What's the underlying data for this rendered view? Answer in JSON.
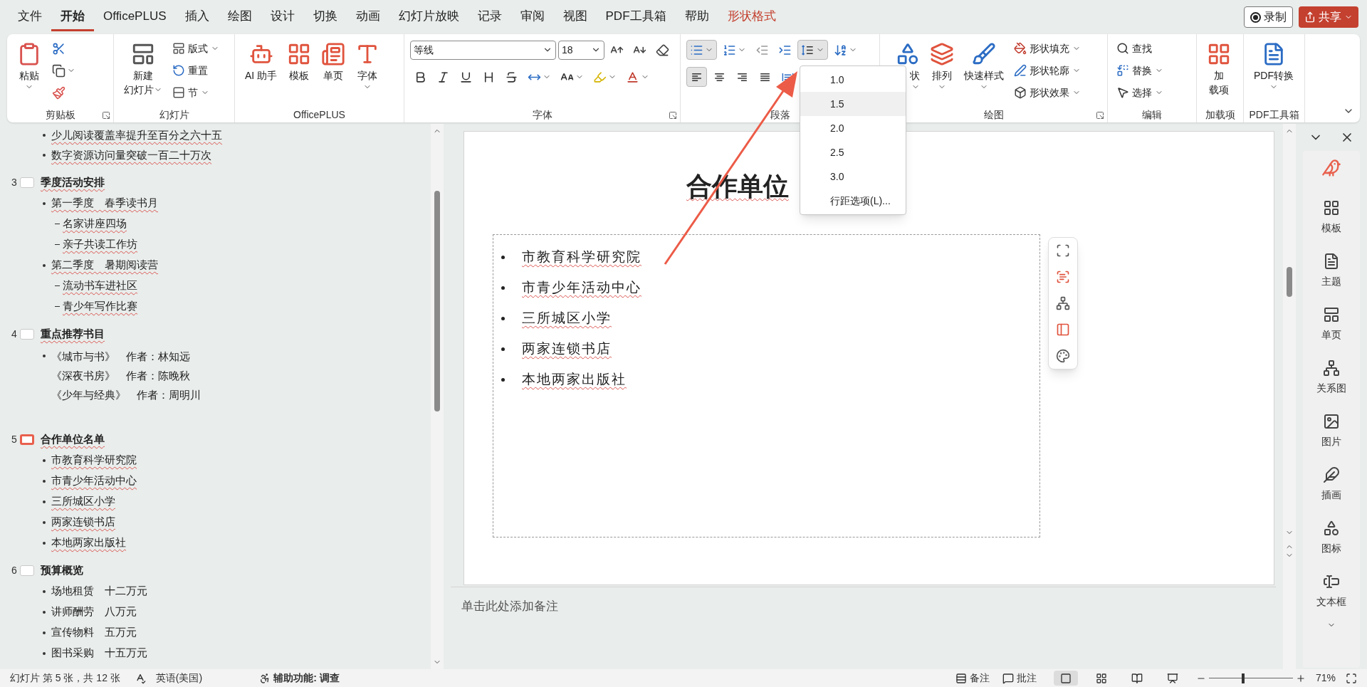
{
  "menu_tabs": [
    {
      "label": "文件",
      "selected": false,
      "kind": "normal"
    },
    {
      "label": "开始",
      "selected": true,
      "kind": "normal"
    },
    {
      "label": "OfficePLUS",
      "selected": false,
      "kind": "normal"
    },
    {
      "label": "插入",
      "selected": false,
      "kind": "normal"
    },
    {
      "label": "绘图",
      "selected": false,
      "kind": "normal"
    },
    {
      "label": "设计",
      "selected": false,
      "kind": "normal"
    },
    {
      "label": "切换",
      "selected": false,
      "kind": "normal"
    },
    {
      "label": "动画",
      "selected": false,
      "kind": "normal"
    },
    {
      "label": "幻灯片放映",
      "selected": false,
      "kind": "normal"
    },
    {
      "label": "记录",
      "selected": false,
      "kind": "normal"
    },
    {
      "label": "审阅",
      "selected": false,
      "kind": "normal"
    },
    {
      "label": "视图",
      "selected": false,
      "kind": "normal"
    },
    {
      "label": "PDF工具箱",
      "selected": false,
      "kind": "normal"
    },
    {
      "label": "帮助",
      "selected": false,
      "kind": "normal"
    },
    {
      "label": "形状格式",
      "selected": false,
      "kind": "contextual"
    }
  ],
  "record_button": "录制",
  "share_button": "共享",
  "ribbon": {
    "groups": [
      {
        "label": "剪贴板",
        "launcher": true,
        "columns": [
          {
            "kind": "large",
            "controls": [
              {
                "label": "粘贴",
                "dropdown": true
              }
            ]
          },
          {
            "kind": "stack",
            "controls": [
              {
                "kind": "icon",
                "dropdown": false
              },
              {
                "kind": "icon",
                "dropdown": true
              },
              {
                "kind": "icon",
                "dropdown": false
              }
            ]
          }
        ]
      },
      {
        "label": "幻灯片",
        "launcher": false,
        "columns": [
          {
            "kind": "large",
            "controls": [
              {
                "lines": [
                  "新建",
                  "幻灯片"
                ],
                "dropdown": true
              }
            ]
          },
          {
            "kind": "stack",
            "controls": [
              {
                "kind": "small",
                "label": "版式",
                "dropdown": true
              },
              {
                "kind": "small",
                "label": "重置",
                "dropdown": false
              },
              {
                "kind": "small",
                "label": "节",
                "dropdown": true
              }
            ]
          }
        ]
      },
      {
        "label": "OfficePLUS",
        "launcher": false,
        "columns": [
          {
            "kind": "large",
            "controls": [
              {
                "label": "AI 助手",
                "dropdown": false
              },
              {
                "label": "模板",
                "dropdown": false
              },
              {
                "label": "单页",
                "dropdown": false
              },
              {
                "label": "字体",
                "dropdown": true
              }
            ]
          }
        ]
      },
      {
        "label": "字体",
        "launcher": true,
        "columns": [
          {
            "kind": "rows",
            "rows": [
              [
                {
                  "kind": "combo",
                  "value": "等线"
                },
                {
                  "kind": "combo",
                  "value": "18"
                },
                {
                  "kind": "icon",
                  "dropdown": false
                },
                {
                  "kind": "icon",
                  "dropdown": false
                },
                {
                  "kind": "icon",
                  "dropdown": false
                }
              ],
              [
                {
                  "kind": "icon",
                  "dropdown": false
                },
                {
                  "kind": "icon",
                  "dropdown": false
                },
                {
                  "kind": "icon",
                  "dropdown": false
                },
                {
                  "kind": "icon",
                  "dropdown": false
                },
                {
                  "kind": "icon",
                  "dropdown": false
                },
                {
                  "kind": "icon",
                  "dropdown": true
                },
                {
                  "kind": "icon",
                  "dropdown": true
                },
                {
                  "kind": "icon",
                  "dropdown": true
                },
                {
                  "kind": "icon",
                  "dropdown": true
                }
              ]
            ]
          }
        ]
      },
      {
        "label": "段落",
        "launcher": false,
        "columns": [
          {
            "kind": "rows",
            "rows": [
              [
                {
                  "kind": "icon",
                  "dropdown": true,
                  "selected": true
                },
                {
                  "kind": "icon",
                  "dropdown": true,
                  "selected": false
                },
                {
                  "kind": "icon",
                  "dropdown": false,
                  "selected": false
                },
                {
                  "kind": "icon",
                  "dropdown": false,
                  "selected": false
                },
                {
                  "kind": "icon",
                  "dropdown": true,
                  "selected": true
                },
                {
                  "kind": "icon",
                  "dropdown": true,
                  "selected": false
                }
              ],
              [
                {
                  "kind": "icon",
                  "dropdown": false,
                  "selected": true
                },
                {
                  "kind": "icon",
                  "dropdown": false,
                  "selected": false
                },
                {
                  "kind": "icon",
                  "dropdown": false,
                  "selected": false
                },
                {
                  "kind": "icon",
                  "dropdown": false,
                  "selected": false
                },
                {
                  "kind": "icon",
                  "dropdown": false,
                  "selected": false
                }
              ]
            ]
          }
        ]
      },
      {
        "label": "绘图",
        "launcher": true,
        "columns": [
          {
            "kind": "large",
            "controls": [
              {
                "label": "状",
                "dropdown": true,
                "cut_left": true
              },
              {
                "label": "排列",
                "dropdown": true
              },
              {
                "label": "快速样式",
                "dropdown": true
              }
            ]
          },
          {
            "kind": "stack",
            "controls": [
              {
                "kind": "small",
                "label": "形状填充",
                "dropdown": true
              },
              {
                "kind": "small",
                "label": "形状轮廓",
                "dropdown": true
              },
              {
                "kind": "small",
                "label": "形状效果",
                "dropdown": true
              }
            ]
          }
        ]
      },
      {
        "label": "编辑",
        "launcher": false,
        "columns": [
          {
            "kind": "stack",
            "controls": [
              {
                "kind": "small",
                "label": "查找",
                "dropdown": false
              },
              {
                "kind": "small",
                "label": "替换",
                "dropdown": true
              },
              {
                "kind": "small",
                "label": "选择",
                "dropdown": true
              }
            ]
          }
        ]
      },
      {
        "label": "加载项",
        "launcher": false,
        "columns": [
          {
            "kind": "large",
            "controls": [
              {
                "lines": [
                  "加",
                  "载项"
                ],
                "dropdown": false
              }
            ]
          }
        ]
      },
      {
        "label": "PDF工具箱",
        "launcher": false,
        "columns": [
          {
            "kind": "large",
            "controls": [
              {
                "label": "PDF转换",
                "dropdown": true
              }
            ]
          }
        ]
      }
    ]
  },
  "line_spacing_menu": [
    {
      "label": "1.0",
      "highlighted": false
    },
    {
      "label": "1.5",
      "highlighted": true
    },
    {
      "label": "2.0",
      "highlighted": false
    },
    {
      "label": "2.5",
      "highlighted": false
    },
    {
      "label": "3.0",
      "highlighted": false
    },
    {
      "label": "行距选项(L)...",
      "highlighted": false
    }
  ],
  "outline": {
    "continued_items": [
      {
        "text": "少儿阅读覆盖率提升至百分之六十五",
        "flagged": true
      },
      {
        "text": "数字资源访问量突破一百二十万次",
        "flagged": true
      }
    ],
    "slides": [
      {
        "number": "3",
        "title": "季度活动安排",
        "selected": false,
        "flagged": true,
        "items": [
          {
            "text": "第一季度　春季读书月",
            "flagged": true,
            "children": [
              {
                "text": "名家讲座四场",
                "flagged": true
              },
              {
                "text": "亲子共读工作坊",
                "flagged": true
              }
            ]
          },
          {
            "text": "第二季度　暑期阅读营",
            "flagged": true,
            "children": [
              {
                "text": "流动书车进社区",
                "flagged": true
              },
              {
                "text": "青少年写作比赛",
                "flagged": true
              }
            ]
          }
        ]
      },
      {
        "number": "4",
        "title": "重点推荐书目",
        "selected": false,
        "flagged": true,
        "items": [
          {
            "lines": [
              "《城市与书》　作者：林知远",
              "《深夜书房》　作者：陈晚秋",
              "《少年与经典》　作者：周明川"
            ],
            "flagged": false
          }
        ]
      },
      {
        "number": "5",
        "title": "合作单位名单",
        "selected": true,
        "flagged": true,
        "items": [
          {
            "text": "市教育科学研究院",
            "flagged": true
          },
          {
            "text": "市青少年活动中心",
            "flagged": true
          },
          {
            "text": "三所城区小学",
            "flagged": true
          },
          {
            "text": "两家连锁书店",
            "flagged": true
          },
          {
            "text": "本地两家出版社",
            "flagged": true
          }
        ]
      },
      {
        "number": "6",
        "title": "预算概览",
        "selected": false,
        "flagged": false,
        "items": [
          {
            "text": "场地租赁　十二万元",
            "flagged": false
          },
          {
            "text": "讲师酬劳　八万元",
            "flagged": false
          },
          {
            "text": "宣传物料　五万元",
            "flagged": false
          },
          {
            "text": "图书采购　十五万元",
            "flagged": false
          }
        ]
      }
    ]
  },
  "slide": {
    "title": "合作单位",
    "bullets": [
      "市教育科学研究院",
      "市青少年活动中心",
      "三所城区小学",
      "两家连锁书店",
      "本地两家出版社"
    ]
  },
  "notes_placeholder": "单击此处添加备注",
  "side_panel": {
    "items": [
      "模板",
      "主题",
      "单页",
      "关系图",
      "图片",
      "插画",
      "图标",
      "文本框"
    ]
  },
  "status_bar": {
    "slide_info": "幻灯片 第 5 张，共 12 张",
    "language": "英语(美国)",
    "accessibility": "辅助功能: 调查",
    "notes": "备注",
    "comments": "批注",
    "views": [
      {
        "selected": true
      },
      {
        "selected": false
      },
      {
        "selected": false
      },
      {
        "selected": false
      }
    ],
    "zoom": {
      "level": 0.41,
      "reading": "71%"
    }
  }
}
